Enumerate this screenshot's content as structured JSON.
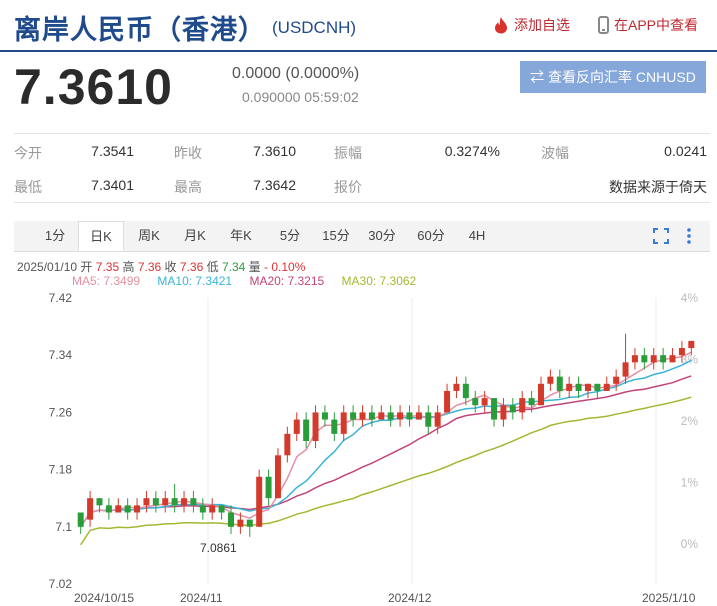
{
  "header": {
    "title": "离岸人民币（香港）",
    "code": "(USDCNH)",
    "add_watchlist": "添加自选",
    "view_in_app": "在APP中查看"
  },
  "quote": {
    "price": "7.3610",
    "change": "0.0000 (0.0000%)",
    "sub": "0.090000 05:59:02",
    "reverse_button": "⇄ 查看反向汇率 CNHUSD"
  },
  "stats": {
    "row1": [
      {
        "label": "今开",
        "value": "7.3541"
      },
      {
        "label": "昨收",
        "value": "7.3610"
      },
      {
        "label": "振幅",
        "value": "0.3274%"
      },
      {
        "label": "波幅",
        "value": "0.0241"
      }
    ],
    "row2": [
      {
        "label": "最低",
        "value": "7.3401"
      },
      {
        "label": "最高",
        "value": "7.3642"
      },
      {
        "label": "报价",
        "value": ""
      },
      {
        "label": "",
        "value": "数据来源于倚天"
      }
    ]
  },
  "tabs": [
    "1分",
    "日K",
    "周K",
    "月K",
    "年K",
    "5分",
    "15分",
    "30分",
    "60分",
    "4H"
  ],
  "active_tab": "日K",
  "ohlc": {
    "date": "2025/01/10",
    "open_label": "开",
    "open": "7.35",
    "high_label": "高",
    "high": "7.36",
    "close_label": "收",
    "close": "7.36",
    "low_label": "低",
    "low": "7.34",
    "vol_label": "量",
    "vol": "- 0.10%"
  },
  "ma_legend": {
    "ma5": "MA5: 7.3499",
    "ma10": "MA10: 7.3421",
    "ma20": "MA20: 7.3215",
    "ma30": "MA30: 7.3062"
  },
  "colors": {
    "brand": "#1f4a8c",
    "up": "#d33a2c",
    "down": "#2a9d3a",
    "ma5": "#e58fa3",
    "ma10": "#3cb4d8",
    "ma20": "#c2457a",
    "ma30": "#a5b731"
  },
  "chart_data": {
    "type": "candlestick",
    "ylim": [
      7.02,
      7.42
    ],
    "yticks": [
      "7.42",
      "7.34",
      "7.26",
      "7.18",
      "7.1",
      "7.02"
    ],
    "right_ticks": [
      "4%",
      "3%",
      "2%",
      "1%",
      "0%"
    ],
    "xticks": [
      "2024/10/15",
      "2024/11",
      "2024/12",
      "2025/1/10"
    ],
    "min_label": "7.0861",
    "candles": [
      [
        7.12,
        7.1,
        7.11,
        7.09
      ],
      [
        7.11,
        7.14,
        7.15,
        7.1
      ],
      [
        7.14,
        7.13,
        7.14,
        7.12
      ],
      [
        7.13,
        7.12,
        7.14,
        7.11
      ],
      [
        7.12,
        7.13,
        7.14,
        7.12
      ],
      [
        7.13,
        7.12,
        7.14,
        7.11
      ],
      [
        7.12,
        7.13,
        7.14,
        7.11
      ],
      [
        7.13,
        7.14,
        7.15,
        7.12
      ],
      [
        7.14,
        7.13,
        7.15,
        7.12
      ],
      [
        7.13,
        7.14,
        7.15,
        7.12
      ],
      [
        7.14,
        7.13,
        7.16,
        7.12
      ],
      [
        7.13,
        7.14,
        7.15,
        7.12
      ],
      [
        7.14,
        7.13,
        7.15,
        7.12
      ],
      [
        7.13,
        7.12,
        7.14,
        7.11
      ],
      [
        7.12,
        7.13,
        7.14,
        7.11
      ],
      [
        7.13,
        7.12,
        7.13,
        7.11
      ],
      [
        7.12,
        7.1,
        7.13,
        7.09
      ],
      [
        7.1,
        7.11,
        7.12,
        7.09
      ],
      [
        7.11,
        7.1,
        7.11,
        7.086
      ],
      [
        7.1,
        7.17,
        7.18,
        7.1
      ],
      [
        7.17,
        7.14,
        7.18,
        7.13
      ],
      [
        7.14,
        7.2,
        7.21,
        7.14
      ],
      [
        7.2,
        7.23,
        7.24,
        7.19
      ],
      [
        7.23,
        7.25,
        7.26,
        7.22
      ],
      [
        7.25,
        7.22,
        7.26,
        7.21
      ],
      [
        7.22,
        7.26,
        7.27,
        7.21
      ],
      [
        7.26,
        7.25,
        7.27,
        7.24
      ],
      [
        7.25,
        7.23,
        7.26,
        7.22
      ],
      [
        7.23,
        7.26,
        7.27,
        7.22
      ],
      [
        7.26,
        7.25,
        7.27,
        7.24
      ],
      [
        7.25,
        7.26,
        7.27,
        7.24
      ],
      [
        7.26,
        7.25,
        7.27,
        7.24
      ],
      [
        7.25,
        7.26,
        7.27,
        7.25
      ],
      [
        7.26,
        7.25,
        7.27,
        7.24
      ],
      [
        7.25,
        7.26,
        7.27,
        7.24
      ],
      [
        7.26,
        7.25,
        7.27,
        7.24
      ],
      [
        7.25,
        7.26,
        7.27,
        7.25
      ],
      [
        7.26,
        7.24,
        7.27,
        7.23
      ],
      [
        7.24,
        7.26,
        7.27,
        7.23
      ],
      [
        7.26,
        7.29,
        7.3,
        7.26
      ],
      [
        7.29,
        7.3,
        7.31,
        7.28
      ],
      [
        7.3,
        7.28,
        7.31,
        7.27
      ],
      [
        7.28,
        7.27,
        7.29,
        7.26
      ],
      [
        7.27,
        7.28,
        7.29,
        7.26
      ],
      [
        7.28,
        7.25,
        7.28,
        7.24
      ],
      [
        7.25,
        7.27,
        7.28,
        7.24
      ],
      [
        7.27,
        7.26,
        7.28,
        7.25
      ],
      [
        7.26,
        7.28,
        7.29,
        7.25
      ],
      [
        7.28,
        7.27,
        7.29,
        7.26
      ],
      [
        7.27,
        7.3,
        7.31,
        7.27
      ],
      [
        7.3,
        7.31,
        7.32,
        7.29
      ],
      [
        7.31,
        7.29,
        7.32,
        7.28
      ],
      [
        7.29,
        7.3,
        7.31,
        7.28
      ],
      [
        7.3,
        7.29,
        7.31,
        7.28
      ],
      [
        7.29,
        7.3,
        7.3,
        7.28
      ],
      [
        7.3,
        7.29,
        7.3,
        7.28
      ],
      [
        7.29,
        7.3,
        7.31,
        7.29
      ],
      [
        7.3,
        7.31,
        7.32,
        7.29
      ],
      [
        7.31,
        7.33,
        7.37,
        7.3
      ],
      [
        7.33,
        7.34,
        7.35,
        7.32
      ],
      [
        7.34,
        7.33,
        7.35,
        7.32
      ],
      [
        7.33,
        7.34,
        7.35,
        7.32
      ],
      [
        7.34,
        7.33,
        7.35,
        7.32
      ],
      [
        7.33,
        7.34,
        7.35,
        7.33
      ],
      [
        7.34,
        7.35,
        7.36,
        7.33
      ],
      [
        7.35,
        7.36,
        7.36,
        7.34
      ]
    ]
  }
}
